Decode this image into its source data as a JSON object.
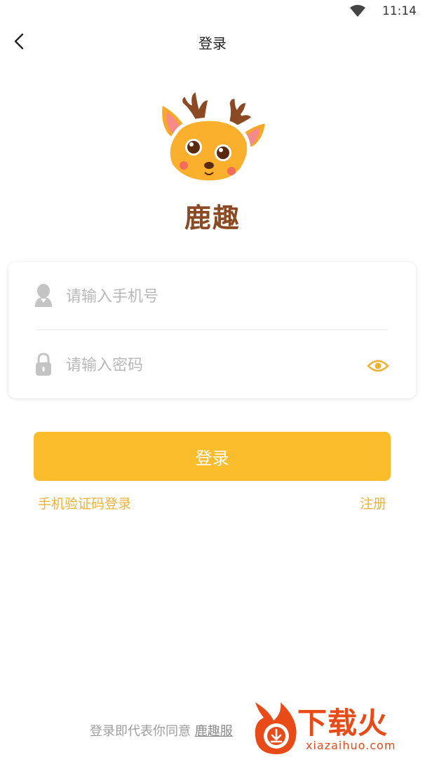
{
  "status_bar": {
    "time": "11:14"
  },
  "nav": {
    "title": "登录"
  },
  "brand": {
    "name": "鹿趣"
  },
  "form": {
    "phone_placeholder": "请输入手机号",
    "password_placeholder": "请输入密码"
  },
  "actions": {
    "login_label": "登录",
    "sms_login_label": "手机验证码登录",
    "register_label": "注册"
  },
  "footer": {
    "agreement_prefix": "登录即代表你同意",
    "agreement_link": "鹿趣服"
  },
  "watermark": {
    "text": "下载火",
    "domain": "xiazaihuo.com"
  },
  "colors": {
    "accent": "#fcbd2d",
    "link": "#f0b233",
    "placeholder": "#b8b8b8",
    "icon_gray": "#c4c4c4"
  }
}
